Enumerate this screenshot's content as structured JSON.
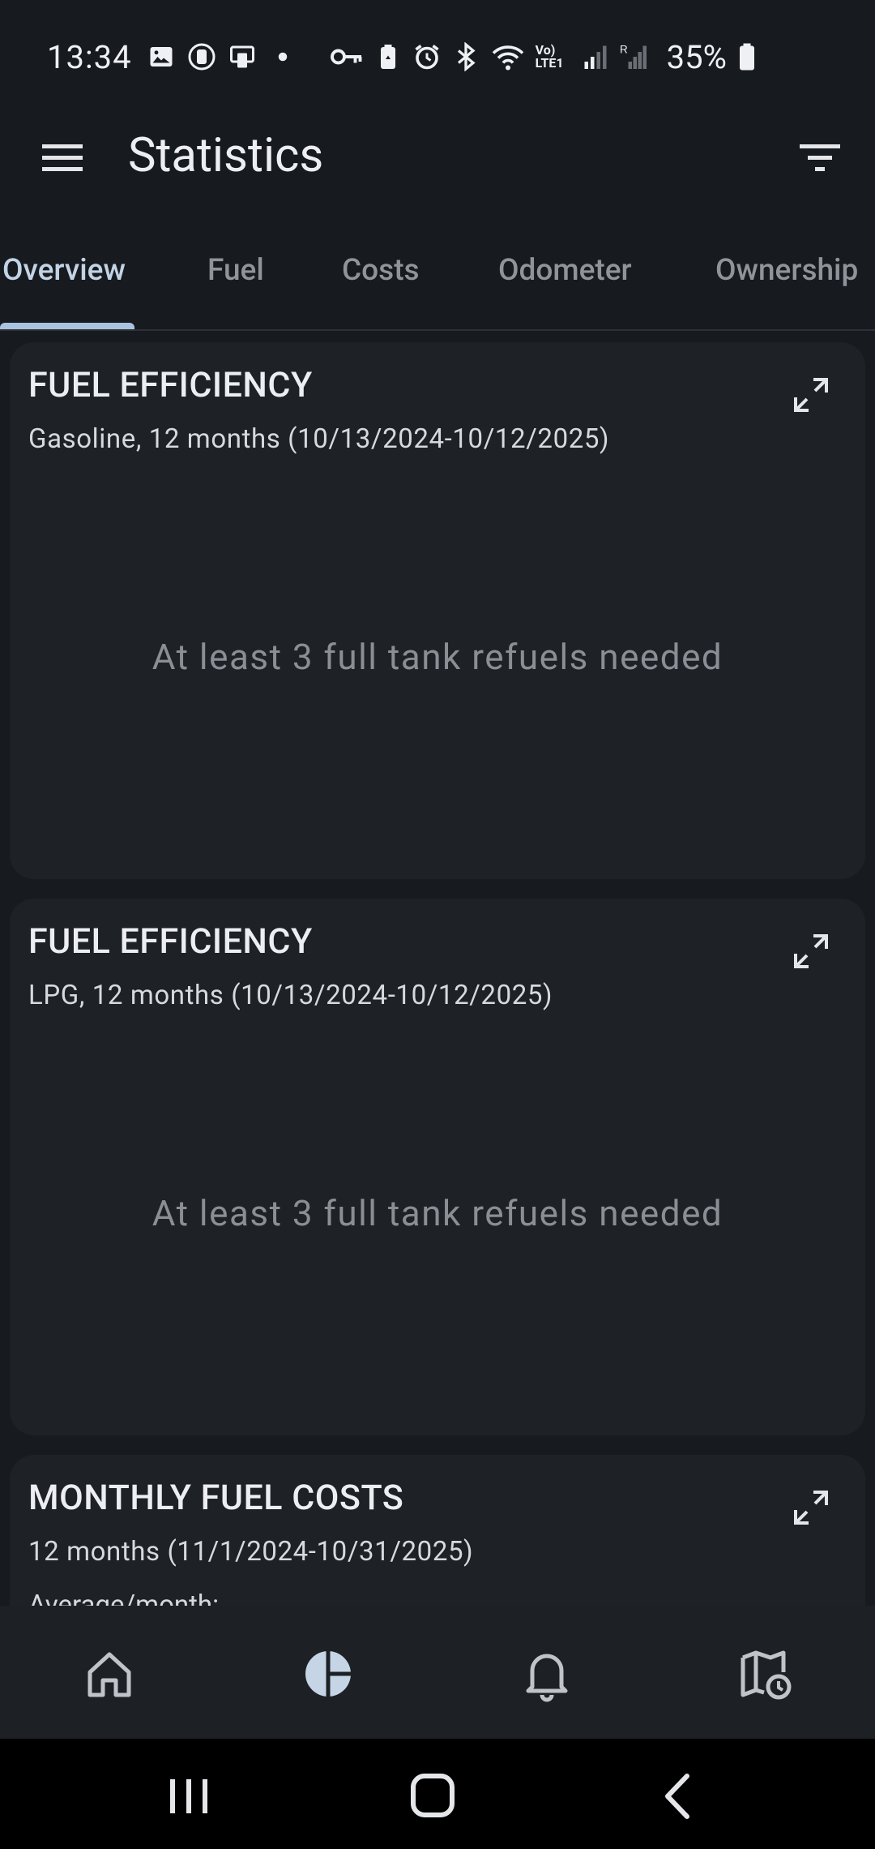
{
  "status_bar": {
    "time": "13:34",
    "battery": "35%",
    "left_icons": [
      "image-icon",
      "screen-record-icon",
      "cast-icon",
      "dot-icon"
    ],
    "right_icons": [
      "vpn-key-icon",
      "recycle-battery-icon",
      "alarm-icon",
      "bluetooth-icon",
      "wifi-icon",
      "volte-icon",
      "signal-icon",
      "roaming-signal-icon",
      "battery-icon"
    ],
    "volte_label": "Vo) LTE1"
  },
  "app_bar": {
    "title": "Statistics",
    "menu_icon": "menu-icon",
    "filter_icon": "filter-icon"
  },
  "tabs": [
    {
      "label": "Overview",
      "active": true
    },
    {
      "label": "Fuel",
      "active": false
    },
    {
      "label": "Costs",
      "active": false
    },
    {
      "label": "Odometer",
      "active": false
    },
    {
      "label": "Ownership",
      "active": false
    }
  ],
  "cards": [
    {
      "title": "FUEL EFFICIENCY",
      "subtitle": "Gasoline, 12 months (10/13/2024-10/12/2025)",
      "message": "At least 3 full tank refuels needed",
      "expand_icon": "expand-icon"
    },
    {
      "title": "FUEL EFFICIENCY",
      "subtitle": "LPG, 12 months (10/13/2024-10/12/2025)",
      "message": "At least 3 full tank refuels needed",
      "expand_icon": "expand-icon"
    },
    {
      "title": "MONTHLY FUEL COSTS",
      "subtitle": "12 months (11/1/2024-10/31/2025)",
      "peek_text": "Average/month:",
      "expand_icon": "expand-icon"
    }
  ],
  "bottom_nav": [
    {
      "icon": "home-icon",
      "active": false
    },
    {
      "icon": "statistics-icon",
      "active": true
    },
    {
      "icon": "notifications-icon",
      "active": false
    },
    {
      "icon": "trips-map-icon",
      "active": false
    }
  ],
  "system_nav": [
    "recents-icon",
    "home-button-icon",
    "back-icon"
  ],
  "colors": {
    "background": "#171a1e",
    "card": "#1e2126",
    "tab_active": "#c2d3e6",
    "tab_indicator": "#a9c3e0",
    "tab_inactive": "#8f949b",
    "nav_active": "#c5d5e6"
  }
}
